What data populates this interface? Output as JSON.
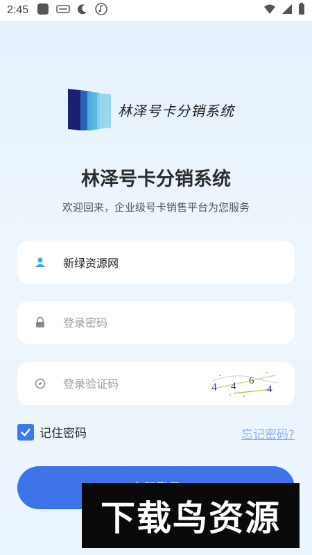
{
  "status_bar": {
    "time": "2:45",
    "icons": [
      "app-icon",
      "keyboard-icon",
      "moon-icon",
      "music-icon"
    ],
    "right_icons": [
      "wifi-icon",
      "signal-icon",
      "battery-icon"
    ]
  },
  "logo": {
    "text": "林泽号卡分销系统",
    "colors": [
      "#1a1f6e",
      "#2a63b8",
      "#4fb3df",
      "#8fd3ec"
    ]
  },
  "header": {
    "title": "林泽号卡分销系统",
    "subtitle": "欢迎回来，企业级号卡销售平台为您服务"
  },
  "form": {
    "username": {
      "value": "新绿资源网",
      "placeholder": "",
      "icon": "user-icon"
    },
    "password": {
      "value": "",
      "placeholder": "登录密码",
      "icon": "lock-icon"
    },
    "captcha": {
      "value": "",
      "placeholder": "登录验证码",
      "icon": "compass-icon",
      "code": "4464"
    }
  },
  "options": {
    "remember_label": "记住密码",
    "remember_checked": true,
    "forgot_label": "忘记密码?"
  },
  "login_button": {
    "label": "立即登录"
  },
  "watermark": {
    "text": "下载鸟资源"
  },
  "colors": {
    "accent": "#3f73e8",
    "checkbox": "#3c79e6",
    "link": "#8db3e6"
  }
}
